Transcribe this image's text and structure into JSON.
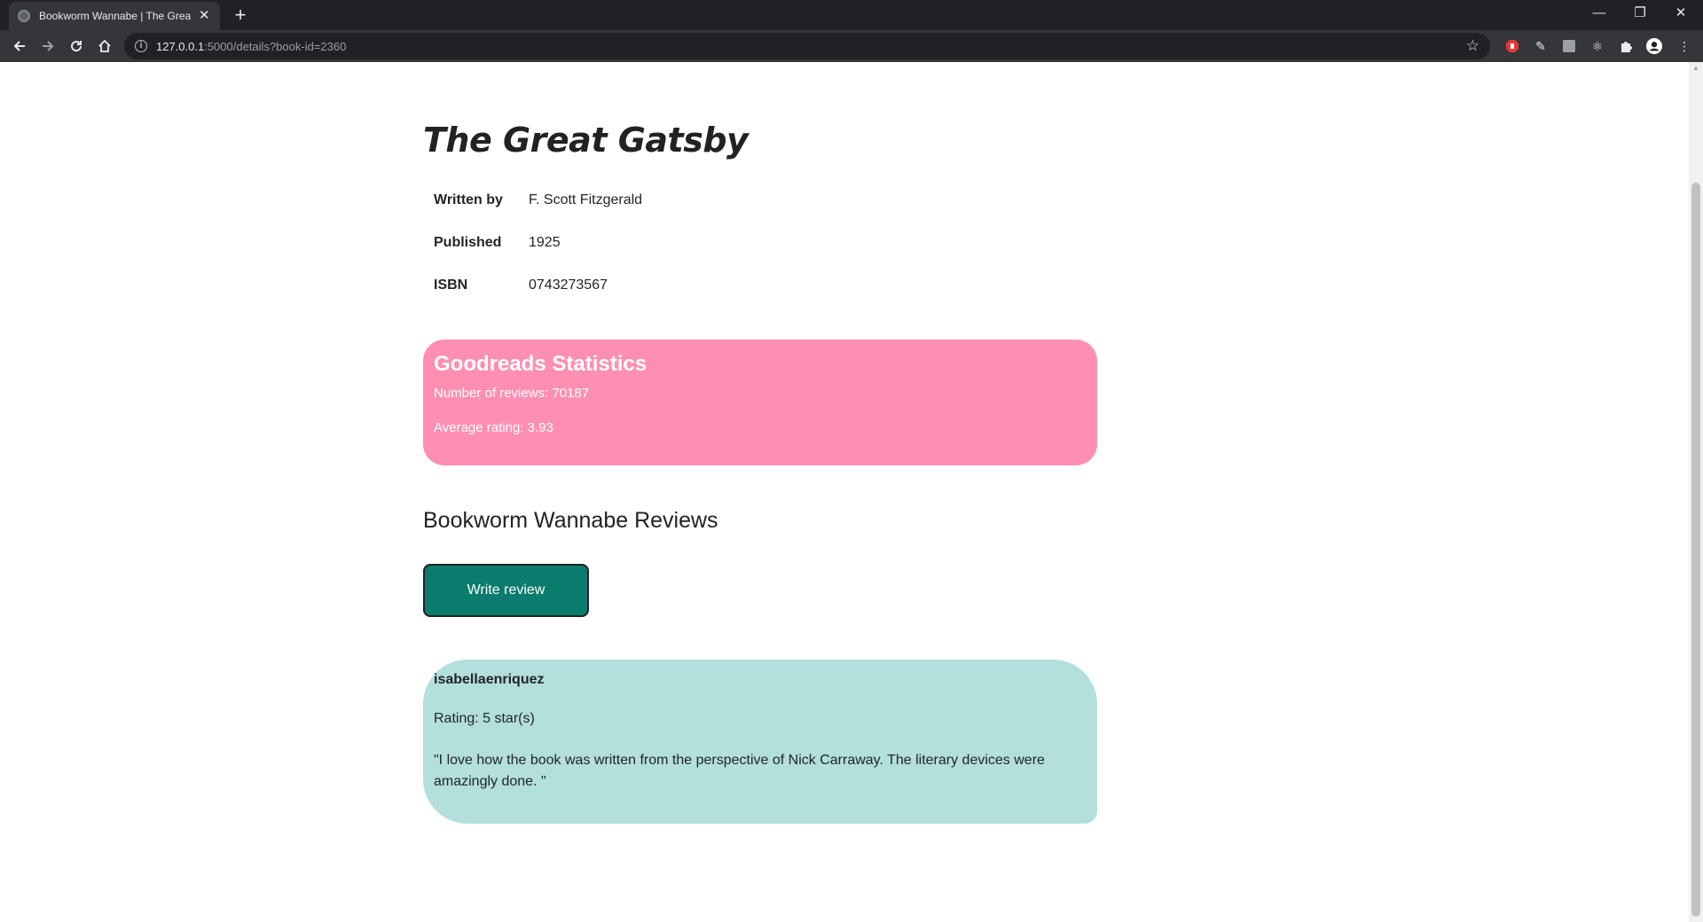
{
  "browser": {
    "tab_title": "Bookworm Wannabe | The Great",
    "url_host": "127.0.0.1",
    "url_path": ":5000/details?book-id=2360"
  },
  "book": {
    "title": "The Great Gatsby",
    "details": [
      {
        "label": "Written by",
        "value": "F. Scott Fitzgerald"
      },
      {
        "label": "Published",
        "value": "1925"
      },
      {
        "label": "ISBN",
        "value": "0743273567"
      }
    ]
  },
  "goodreads": {
    "heading": "Goodreads Statistics",
    "reviews_line": "Number of reviews: 70187",
    "rating_line": "Average rating: 3.93"
  },
  "reviews": {
    "heading": "Bookworm Wannabe Reviews",
    "write_button": "Write review",
    "items": [
      {
        "user": "isabellaenriquez",
        "rating": "Rating: 5 star(s)",
        "text": "\"I love how the book was written from the perspective of Nick Carraway. The literary devices were amazingly done. \""
      }
    ]
  },
  "colors": {
    "stats_bg": "#ff8fb2",
    "review_bg": "#b3dfdd",
    "button_bg": "#0a7b6c"
  }
}
